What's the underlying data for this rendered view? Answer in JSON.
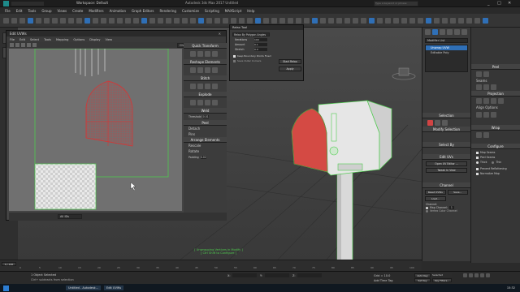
{
  "window": {
    "title": "Workspace: Default",
    "app_title": "Autodesk 3ds Max 2017    Untitled"
  },
  "menu": [
    "File",
    "Edit",
    "Tools",
    "Group",
    "Views",
    "Create",
    "Modifiers",
    "Animation",
    "Graph Editors",
    "Rendering",
    "Customize",
    "Scripting",
    "MAXScript",
    "Help"
  ],
  "search_placeholder": "Type a keyword or phrase",
  "uvw": {
    "title": "Edit UVWs",
    "menu": [
      "File",
      "Edit",
      "Select",
      "Tools",
      "Mapping",
      "Options",
      "Display",
      "View"
    ],
    "checker": "CheckerPattern  ( Checker )",
    "side_sections": {
      "quick_transform": "Quick Transform",
      "reshape_elements": "Reshape Elements",
      "stitch": "Stitch",
      "explode": "Explode",
      "weld": "Weld",
      "threshold_label": "Threshold",
      "threshold_value": "0.01",
      "peel": "Peel",
      "detach": "Detach",
      "pins": "Pins",
      "arrange_elements": "Arrange Elements",
      "rescale": "Rescale",
      "rotate": "Rotate",
      "padding_label": "Padding",
      "padding_value": "0.02"
    },
    "bottom_dropdown": "All IDs",
    "coords": {
      "u": "U:",
      "v": "V:",
      "w": "W:"
    }
  },
  "unwrap": {
    "title": "Relax Tool",
    "mode": "Relax By Polygon Angles",
    "iterations_label": "Iterations",
    "iterations_value": "100",
    "amount_label": "Amount",
    "amount_value": "0.1",
    "stretch_label": "Stretch",
    "stretch_value": "0.0",
    "keep_boundary": "Keep Boundary Points Fixed",
    "save_outer": "Save Outer Corners",
    "start_btn": "Start Relax",
    "apply_btn": "Apply"
  },
  "modifier_list": {
    "dropdown": "Modifier List",
    "items": [
      "Unwrap UVW",
      "Editable Poly"
    ]
  },
  "right_panel": {
    "peel": "Peel",
    "seams": "Seams",
    "projection": "Projection",
    "align_options": "Align Options",
    "wrap": "Wrap",
    "configure": "Configure",
    "map_seams": "Map Seams",
    "peel_seams": "Peel Seams",
    "thick": "Thick",
    "thin": "Thin",
    "prevent_reflattening": "Prevent Reflattening",
    "normalize_map": "Normalize Map"
  },
  "cmd_panel": {
    "selection": "Selection",
    "modify_selection": "Modify Selection",
    "select_by": "Select By",
    "edit_uvs": "Edit UVs",
    "open_uv_editor": "Open UV Editor ...",
    "tweak_in_view": "Tweak In View",
    "channel": "Channel",
    "reset_uvws": "Reset UVWs",
    "save": "Save...",
    "load": "Load...",
    "channel_label": "Channel:",
    "map_channel": "Map Channel:",
    "map_channel_value": "1",
    "vertex_color_channel": "Vertex Color Channel"
  },
  "viewport": {
    "caption_line1": "[ Unwrapping Vertices in Modify ]",
    "caption_line2": "[ Ctrl Shift to Configure ]"
  },
  "timeline": {
    "frame_label": "0 / 100",
    "ticks": [
      "0",
      "5",
      "10",
      "15",
      "20",
      "25",
      "30",
      "35",
      "40",
      "45",
      "50",
      "55",
      "60",
      "65",
      "70",
      "75",
      "80",
      "85",
      "90",
      "95",
      "100"
    ]
  },
  "status": {
    "selected": "1 Object Selected",
    "prompt": "Ctrl+ subtracts from selection",
    "x": "X:",
    "y": "Y:",
    "z": "Z:",
    "grid": "Grid = 10.0",
    "autokey": "Auto Key",
    "selected_dd": "Selected",
    "set_key": "Set Key",
    "key_filters": "Key Filters...",
    "add_time_tag": "Add Time Tag"
  },
  "taskbar": {
    "clock": "15:32",
    "date": "2021-09-26",
    "items": [
      "Untitled - Autodesk...",
      "Edit UVWs"
    ]
  },
  "colors": {
    "accent": "#2f6fb6",
    "uvw_red": "#cc3b3b",
    "seam_green": "#4ecb4e"
  }
}
